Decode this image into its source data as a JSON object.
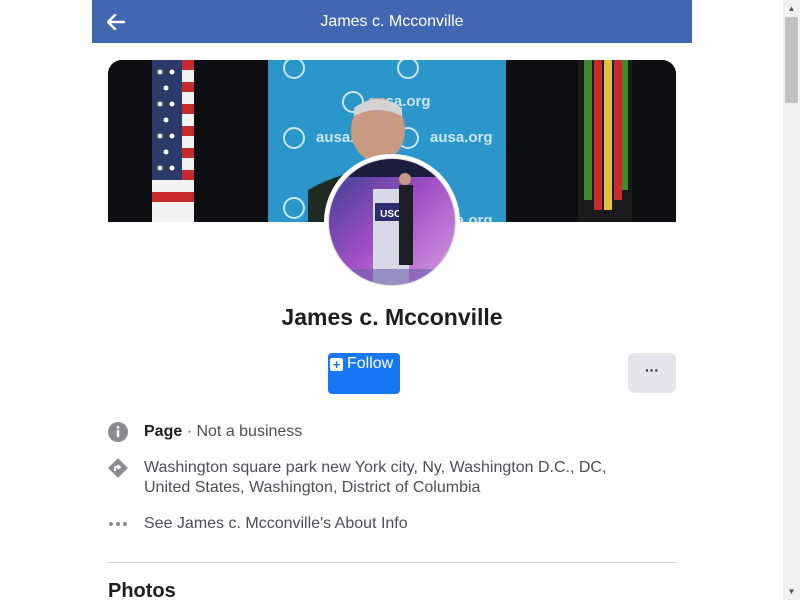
{
  "header": {
    "title": "James c. Mcconville",
    "back_icon": "arrow-left-icon",
    "color": "#4267b2"
  },
  "profile": {
    "name": "James c. Mcconville",
    "cover_icon": "cover-photo",
    "avatar_icon": "profile-photo"
  },
  "actions": {
    "follow_label": "Follow",
    "follow_icon": "plus-square-icon",
    "more_label": "···",
    "accent": "#1877f2"
  },
  "info": {
    "category_bold": "Page",
    "category_rest": " · Not a business",
    "address": "Washington square park new York city, Ny, Washington D.C., DC, United States, Washington, District of Columbia",
    "about_link": "See James c. Mcconville's About Info"
  },
  "sections": {
    "photos_title": "Photos"
  }
}
